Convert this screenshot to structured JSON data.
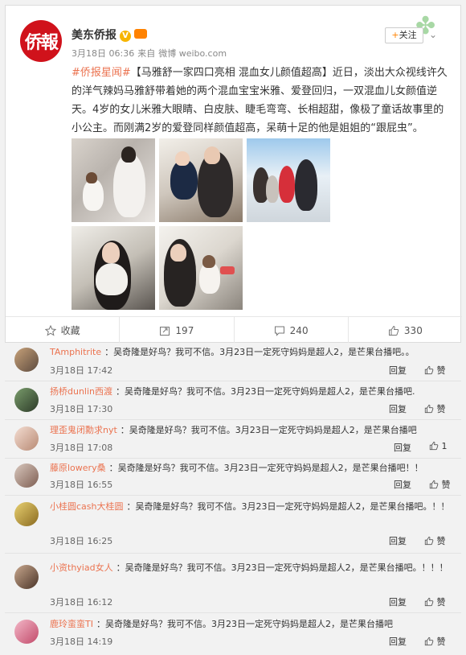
{
  "post": {
    "avatar_text": "侨報",
    "author": "美东侨报",
    "date": "3月18日 06:36",
    "source_prefix": "来自",
    "source": "微博 weibo.com",
    "follow_label": "关注",
    "topic": "#侨报星闻#",
    "text_after_topic": "【马雅舒一家四口亮相 混血女儿颜值超高】近日，淡出大众视线许久的洋气辣妈马雅舒带着她的两个混血宝宝米雅、爱登回归，一双混血儿女颜值逆天。4岁的女儿米雅大眼睛、白皮肤、睫毛弯弯、长相超甜，像极了童话故事里的小公主。而刚满2岁的爱登同样颜值超高，呆萌十足的他是姐姐的“跟屁虫”。",
    "actions": [
      {
        "label": "收藏"
      },
      {
        "label": "197"
      },
      {
        "label": "240"
      },
      {
        "label": "330"
      }
    ]
  },
  "comments": [
    {
      "name": "TAmphitrite",
      "text": "：吴奇隆是好鸟？我可不信。3月23日一定死守妈妈是超人2，是芒果台播吧。。",
      "time": "3月18日 17:42",
      "reply": "回复",
      "likes": "赞"
    },
    {
      "name": "扬桥dunlin西渡",
      "text": "：吴奇隆是好鸟？我可不信。3月23日一定死守妈妈是超人2，是芒果台播吧.",
      "time": "3月18日 17:30",
      "reply": "回复",
      "likes": "赞"
    },
    {
      "name": "理歪鬼闭勳求nyt",
      "text": "：吴奇隆是好鸟？我可不信。3月23日一定死守妈妈是超人2，是芒果台播吧",
      "time": "3月18日 17:08",
      "reply": "回复",
      "likes": "1"
    },
    {
      "name": "藤原lowery桑",
      "text": "：吴奇隆是好鸟？我可不信。3月23日一定死守妈妈是超人2，是芒果台播吧！！",
      "time": "3月18日 16:55",
      "reply": "回复",
      "likes": "赞"
    },
    {
      "name": "小桂圆cash大桂圆",
      "text": "：吴奇隆是好鸟？我可不信。3月23日一定死守妈妈是超人2，是芒果台播吧。！！",
      "time": "3月18日 16:25",
      "reply": "回复",
      "likes": "赞"
    },
    {
      "name": "小资thyiad女人",
      "text": "：吴奇隆是好鸟？我可不信。3月23日一定死守妈妈是超人2，是芒果台播吧。！！！",
      "time": "3月18日 16:12",
      "reply": "回复",
      "likes": "赞"
    },
    {
      "name": "鹿玲蛮蛮TI",
      "text": "：吴奇隆是好鸟？我可不信。3月23日一定死守妈妈是超人2，是芒果台播吧",
      "time": "3月18日 14:19",
      "reply": "回复",
      "likes": "赞"
    }
  ]
}
